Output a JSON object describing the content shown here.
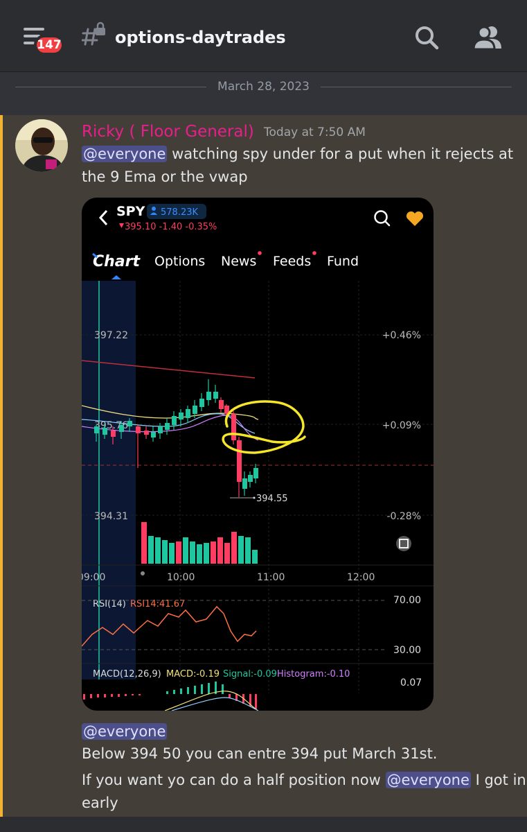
{
  "header": {
    "notification_count": "147",
    "channel_name": "options-daytrades"
  },
  "divider": {
    "date": "March 28, 2023"
  },
  "message": {
    "author": "Ricky ( Floor General)",
    "timestamp": "Today at 7:50 AM",
    "mention": "@everyone",
    "text_line1": "watching spy under for a put when it rejects at",
    "text_line2": "the 9 Ema or the vwap"
  },
  "followups": {
    "mention1": "@everyone",
    "line1": "Below 394 50 you can entre 394 put March 31st.",
    "line2_part1": "If you want yo can do a half position now",
    "mention2": "@everyone",
    "line2_part2": "I got in",
    "line3": "early"
  },
  "attachment": {
    "ticker": "SPY",
    "followers": "578.23K",
    "quote": "395.10 -1.40 -0.35%",
    "tabs": [
      "Chart",
      "Options",
      "News",
      "Feeds",
      "Fund"
    ],
    "price_labels": {
      "high": "397.22",
      "mid": "395.76",
      "low": "394.31",
      "marker": "394.55"
    },
    "pct_labels": {
      "high": "+0.46%",
      "mid": "+0.09%",
      "low": "-0.28%"
    },
    "time_labels": [
      "09:00",
      "10:00",
      "11:00",
      "12:00"
    ],
    "rsi": {
      "label": "RSI(14)",
      "value": "RSI14:41.67",
      "upper": "70.00",
      "lower": "30.00"
    },
    "macd": {
      "label": "MACD(12,26,9)",
      "macd": "MACD:-0.19",
      "signal": "Signal:-0.09",
      "histogram": "Histogram:-0.10",
      "scale": "0.07"
    }
  },
  "colors": {
    "mention_bg": "#4d4f8a",
    "highlight_bar": "#f0b232",
    "author": "#e91e8c",
    "up": "#1fc7a0",
    "down": "#ff3d62",
    "heart": "#f5a623"
  }
}
